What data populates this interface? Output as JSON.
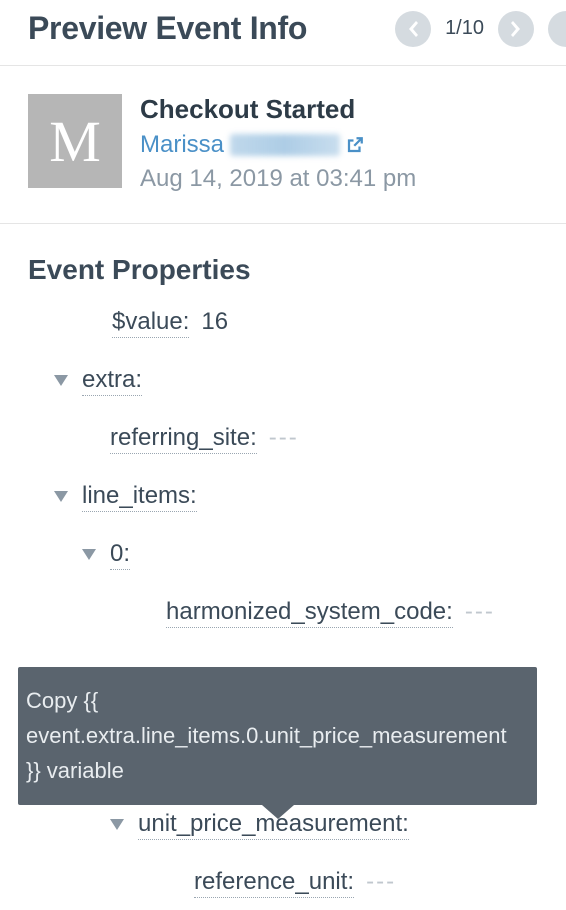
{
  "header": {
    "title": "Preview Event Info",
    "pager": {
      "current": 1,
      "total": 10,
      "text": "1/10"
    }
  },
  "event": {
    "name": "Checkout Started",
    "avatar_letter": "M",
    "user_first": "Marissa",
    "timestamp": "Aug 14, 2019 at 03:41 pm"
  },
  "section_title": "Event Properties",
  "props": {
    "value": {
      "key": "$value:",
      "val": "16"
    },
    "extra": {
      "key": "extra:"
    },
    "referring_site": {
      "key": "referring_site:",
      "val": "---"
    },
    "line_items": {
      "key": "line_items:"
    },
    "idx0": {
      "key": "0:"
    },
    "hsc": {
      "key": "harmonized_system_code:",
      "val": "---"
    },
    "upm": {
      "key": "unit_price_measurement:"
    },
    "ref_unit": {
      "key": "reference_unit:",
      "val": "---"
    }
  },
  "tooltip": {
    "text": "Copy {{ event.extra.line_items.0.unit_price_measurement }} variable"
  }
}
